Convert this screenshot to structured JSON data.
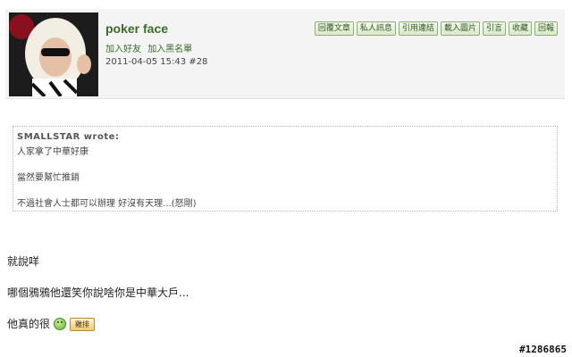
{
  "post": {
    "author": "poker face",
    "add_friend": "加入好友",
    "add_blacklist": "加入黑名單",
    "timestamp": "2011-04-05 15:43",
    "post_number": "#28"
  },
  "toolbar": {
    "buttons": [
      "回覆文章",
      "私人訊息",
      "引用連結",
      "載入圖片",
      "引言",
      "收藏",
      "回報"
    ]
  },
  "quote": {
    "author": "SMALLSTAR wrote:",
    "lines": [
      "人家拿了中華好康",
      "當然要幫忙推銷",
      "不過社會人士都可以辦理 好沒有天理...(怒剛)"
    ]
  },
  "body": {
    "lines": [
      "就說咩",
      "哪個鴉鴉他還笑你說啥你是中華大戶...",
      "他真的很"
    ],
    "sticker_label": "雞排"
  },
  "watermark": "#1286865",
  "colors": {
    "accent_green": "#3a6b2a",
    "header_bg": "#f4f4f4"
  }
}
